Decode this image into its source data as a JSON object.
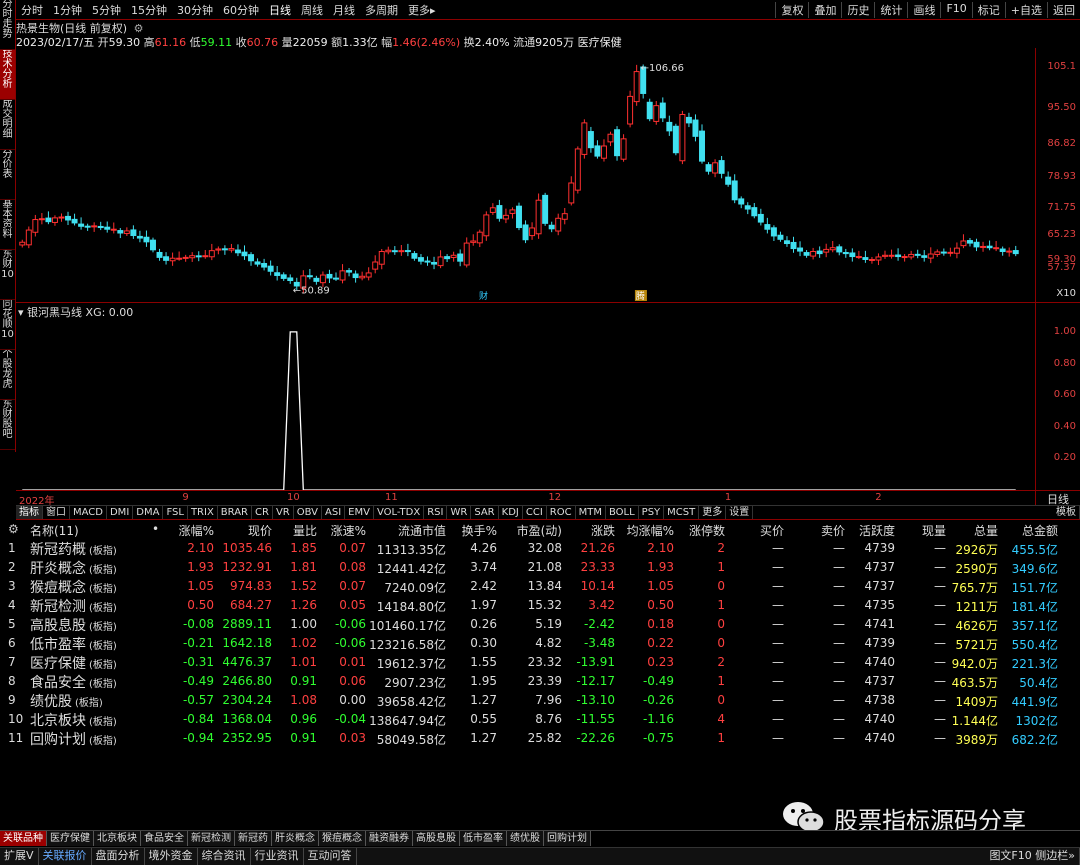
{
  "sidebar": [
    {
      "label": "分时走势",
      "active": false
    },
    {
      "label": "技术分析",
      "active": true
    },
    {
      "label": "成交明细",
      "active": false
    },
    {
      "label": "分价表",
      "active": false
    },
    {
      "label": "基本资料",
      "active": false
    },
    {
      "label": "东财10",
      "active": false
    },
    {
      "label": "同花顺10",
      "active": false
    },
    {
      "label": "个股龙虎",
      "active": false
    },
    {
      "label": "东财股吧",
      "active": false
    }
  ],
  "periods": [
    "分时",
    "1分钟",
    "5分钟",
    "15分钟",
    "30分钟",
    "60分钟",
    "日线",
    "周线",
    "月线",
    "多周期",
    "更多▸"
  ],
  "period_active": "日线",
  "toolbar_right": [
    "复权",
    "叠加",
    "历史",
    "统计",
    "画线",
    "F10",
    "标记",
    "+自选",
    "返回"
  ],
  "title": "热景生物(日线 前复权)",
  "quote": {
    "date": "2023/02/17/五",
    "open_label": "开",
    "open": "59.30",
    "high_label": "高",
    "high": "61.16",
    "low_label": "低",
    "low": "59.11",
    "close_label": "收",
    "close": "60.76",
    "vol_label": "量",
    "vol": "22059",
    "amt_label": "额",
    "amt": "1.33亿",
    "chg_label": "幅",
    "chg": "1.46(2.46%)",
    "turn_label": "换",
    "turn": "2.40%",
    "float_label": "流通",
    "float": "9205万",
    "sector": "医疗保健"
  },
  "chart_data": [
    {
      "type": "candlestick",
      "title": "热景生物(日线 前复权)",
      "y_ticks": [
        "105.1",
        "95.50",
        "86.82",
        "78.93",
        "71.75",
        "65.23",
        "59.30",
        "57.37"
      ],
      "ylim": [
        50,
        109
      ],
      "high_marker": "106.66",
      "low_marker": "50.89",
      "event_markers": [
        "财",
        "腾"
      ],
      "x_labels": [
        "2022年",
        "9",
        "10",
        "11",
        "12",
        "1",
        "2"
      ],
      "scale_label": "X10",
      "closes": [
        63.5,
        66.4,
        68.9,
        69.1,
        68.4,
        69.3,
        69.5,
        68.8,
        68.1,
        67.3,
        67.2,
        67.4,
        67.0,
        66.6,
        66.6,
        65.7,
        66.2,
        65.1,
        64.5,
        63.6,
        61.7,
        59.9,
        59.2,
        59.7,
        59.7,
        59.9,
        60.3,
        60.2,
        60.3,
        61.5,
        61.9,
        61.7,
        62.0,
        61.0,
        60.3,
        59.1,
        58.3,
        57.6,
        56.6,
        55.6,
        54.9,
        54.4,
        53.1,
        55.5,
        55.3,
        54.2,
        55.7,
        55.0,
        54.9,
        56.7,
        56.4,
        55.1,
        55.4,
        56.2,
        58.8,
        61.3,
        61.6,
        61.3,
        61.5,
        61.4,
        59.7,
        59.0,
        58.9,
        58.3,
        60.0,
        59.6,
        60.4,
        59.0,
        63.3,
        63.8,
        65.9,
        70.0,
        71.7,
        69.2,
        69.9,
        71.2,
        67.0,
        64.1,
        66.9,
        73.5,
        68.0,
        66.7,
        69.2,
        70.3,
        77.6,
        85.7,
        91.9,
        86.0,
        84.0,
        86.4,
        89.2,
        84.1,
        88.1,
        98.2,
        104.1,
        98.9,
        92.9,
        96.0,
        93.1,
        90.0,
        84.8,
        93.9,
        91.9,
        88.7,
        82.8,
        80.4,
        82.4,
        79.9,
        77.3,
        73.6,
        72.6,
        71.4,
        69.8,
        68.3,
        66.6,
        65.0,
        64.2,
        63.2,
        62.0,
        61.4,
        60.4,
        61.3,
        60.8,
        61.8,
        62.2,
        61.2,
        60.8,
        60.1,
        60.1,
        59.4,
        59.4,
        60.0,
        60.4,
        60.4,
        60.1,
        60.1,
        60.6,
        60.5,
        59.9,
        60.7,
        61.2,
        61.1,
        61.1,
        62.1,
        63.8,
        63.3,
        62.4,
        62.5,
        62.2,
        62.2,
        61.3,
        61.4,
        60.8
      ]
    },
    {
      "type": "line",
      "title": "银河黑马线",
      "label": "银河黑马线 XG: 0.00",
      "y_ticks": [
        "1.00",
        "0.80",
        "0.60",
        "0.40",
        "0.20"
      ],
      "ylim": [
        0,
        1.05
      ],
      "peak_start_index": 41,
      "peak_end_index": 42
    }
  ],
  "indicator_tabs": [
    "指标",
    "窗口",
    "MACD",
    "DMI",
    "DMA",
    "FSL",
    "TRIX",
    "BRAR",
    "CR",
    "VR",
    "OBV",
    "ASI",
    "EMV",
    "VOL-TDX",
    "RSI",
    "WR",
    "SAR",
    "KDJ",
    "CCI",
    "ROC",
    "MTM",
    "BOLL",
    "PSY",
    "MCST",
    "更多",
    "设置"
  ],
  "indicator_right": [
    "模板",
    "日线"
  ],
  "table": {
    "headers": [
      "名称(11)",
      "•",
      "涨幅%",
      "现价",
      "量比",
      "涨速%",
      "流通市值",
      "换手%",
      "市盈(动)",
      "涨跌",
      "均涨幅%",
      "涨停数",
      "买价",
      "卖价",
      "活跃度",
      "现量",
      "总量",
      "总金额"
    ],
    "rows": [
      {
        "n": "1",
        "name": "新冠药概",
        "tag": "(板指)",
        "chg": "2.10",
        "price": "1035.46",
        "vr": "1.85",
        "spd": "0.07",
        "cap": "11313.35亿",
        "turn": "4.26",
        "pe": "32.08",
        "diff": "21.26",
        "avg": "2.10",
        "lim": "2",
        "bid": "—",
        "ask": "—",
        "act": "4739",
        "cur": "—",
        "vol": "2926万",
        "amt": "455.5亿",
        "c": "red",
        "cv": "red",
        "cs": "red",
        "cd": "red",
        "ca": "red",
        "cl": "red"
      },
      {
        "n": "2",
        "name": "肝炎概念",
        "tag": "(板指)",
        "chg": "1.93",
        "price": "1232.91",
        "vr": "1.81",
        "spd": "0.08",
        "cap": "12441.42亿",
        "turn": "3.74",
        "pe": "21.08",
        "diff": "23.33",
        "avg": "1.93",
        "lim": "1",
        "bid": "—",
        "ask": "—",
        "act": "4737",
        "cur": "—",
        "vol": "2590万",
        "amt": "349.6亿",
        "c": "red",
        "cv": "red",
        "cs": "red",
        "cd": "red",
        "ca": "red",
        "cl": "red"
      },
      {
        "n": "3",
        "name": "猴痘概念",
        "tag": "(板指)",
        "chg": "1.05",
        "price": "974.83",
        "vr": "1.52",
        "spd": "0.07",
        "cap": "7240.09亿",
        "turn": "2.42",
        "pe": "13.84",
        "diff": "10.14",
        "avg": "1.05",
        "lim": "0",
        "bid": "—",
        "ask": "—",
        "act": "4737",
        "cur": "—",
        "vol": "765.7万",
        "amt": "151.7亿",
        "c": "red",
        "cv": "red",
        "cs": "red",
        "cd": "red",
        "ca": "red",
        "cl": "red"
      },
      {
        "n": "4",
        "name": "新冠检测",
        "tag": "(板指)",
        "chg": "0.50",
        "price": "684.27",
        "vr": "1.26",
        "spd": "0.05",
        "cap": "14184.80亿",
        "turn": "1.97",
        "pe": "15.32",
        "diff": "3.42",
        "avg": "0.50",
        "lim": "1",
        "bid": "—",
        "ask": "—",
        "act": "4735",
        "cur": "—",
        "vol": "1211万",
        "amt": "181.4亿",
        "c": "red",
        "cv": "red",
        "cs": "red",
        "cd": "red",
        "ca": "red",
        "cl": "red"
      },
      {
        "n": "5",
        "name": "高股息股",
        "tag": "(板指)",
        "chg": "-0.08",
        "price": "2889.11",
        "vr": "1.00",
        "spd": "-0.06",
        "cap": "101460.17亿",
        "turn": "0.26",
        "pe": "5.19",
        "diff": "-2.42",
        "avg": "0.18",
        "lim": "0",
        "bid": "—",
        "ask": "—",
        "act": "4741",
        "cur": "—",
        "vol": "4626万",
        "amt": "357.1亿",
        "c": "grn",
        "cv": "wht",
        "cs": "grn",
        "cd": "grn",
        "ca": "red",
        "cl": "red"
      },
      {
        "n": "6",
        "name": "低市盈率",
        "tag": "(板指)",
        "chg": "-0.21",
        "price": "1642.18",
        "vr": "1.02",
        "spd": "-0.06",
        "cap": "123216.58亿",
        "turn": "0.30",
        "pe": "4.82",
        "diff": "-3.48",
        "avg": "0.22",
        "lim": "0",
        "bid": "—",
        "ask": "—",
        "act": "4739",
        "cur": "—",
        "vol": "5721万",
        "amt": "550.4亿",
        "c": "grn",
        "cv": "red",
        "cs": "grn",
        "cd": "grn",
        "ca": "red",
        "cl": "red"
      },
      {
        "n": "7",
        "name": "医疗保健",
        "tag": "(板指)",
        "chg": "-0.31",
        "price": "4476.37",
        "vr": "1.01",
        "spd": "0.01",
        "cap": "19612.37亿",
        "turn": "1.55",
        "pe": "23.32",
        "diff": "-13.91",
        "avg": "0.23",
        "lim": "2",
        "bid": "—",
        "ask": "—",
        "act": "4740",
        "cur": "—",
        "vol": "942.0万",
        "amt": "221.3亿",
        "c": "grn",
        "cv": "red",
        "cs": "red",
        "cd": "grn",
        "ca": "red",
        "cl": "red"
      },
      {
        "n": "8",
        "name": "食品安全",
        "tag": "(板指)",
        "chg": "-0.49",
        "price": "2466.80",
        "vr": "0.91",
        "spd": "0.06",
        "cap": "2907.23亿",
        "turn": "1.95",
        "pe": "23.39",
        "diff": "-12.17",
        "avg": "-0.49",
        "lim": "1",
        "bid": "—",
        "ask": "—",
        "act": "4737",
        "cur": "—",
        "vol": "463.5万",
        "amt": "50.4亿",
        "c": "grn",
        "cv": "grn",
        "cs": "red",
        "cd": "grn",
        "ca": "grn",
        "cl": "red"
      },
      {
        "n": "9",
        "name": "绩优股",
        "tag": "(板指)",
        "chg": "-0.57",
        "price": "2304.24",
        "vr": "1.08",
        "spd": "0.00",
        "cap": "39658.42亿",
        "turn": "1.27",
        "pe": "7.96",
        "diff": "-13.10",
        "avg": "-0.26",
        "lim": "0",
        "bid": "—",
        "ask": "—",
        "act": "4738",
        "cur": "—",
        "vol": "1409万",
        "amt": "441.9亿",
        "c": "grn",
        "cv": "red",
        "cs": "wht",
        "cd": "grn",
        "ca": "grn",
        "cl": "red"
      },
      {
        "n": "10",
        "name": "北京板块",
        "tag": "(板指)",
        "chg": "-0.84",
        "price": "1368.04",
        "vr": "0.96",
        "spd": "-0.04",
        "cap": "138647.94亿",
        "turn": "0.55",
        "pe": "8.76",
        "diff": "-11.55",
        "avg": "-1.16",
        "lim": "4",
        "bid": "—",
        "ask": "—",
        "act": "4740",
        "cur": "—",
        "vol": "1.144亿",
        "amt": "1302亿",
        "c": "grn",
        "cv": "grn",
        "cs": "grn",
        "cd": "grn",
        "ca": "grn",
        "cl": "red"
      },
      {
        "n": "11",
        "name": "回购计划",
        "tag": "(板指)",
        "chg": "-0.94",
        "price": "2352.95",
        "vr": "0.91",
        "spd": "0.03",
        "cap": "58049.58亿",
        "turn": "1.27",
        "pe": "25.82",
        "diff": "-22.26",
        "avg": "-0.75",
        "lim": "1",
        "bid": "—",
        "ask": "—",
        "act": "4740",
        "cur": "—",
        "vol": "3989万",
        "amt": "682.2亿",
        "c": "grn",
        "cv": "grn",
        "cs": "red",
        "cd": "grn",
        "ca": "grn",
        "cl": "red"
      }
    ]
  },
  "bottom_tabs": [
    "关联品种",
    "医疗保健",
    "北京板块",
    "食品安全",
    "新冠检测",
    "新冠药",
    "肝炎概念",
    "猴痘概念",
    "融资融券",
    "高股息股",
    "低市盈率",
    "绩优股",
    "回购计划"
  ],
  "status_tabs": [
    "扩展V",
    "关联报价",
    "盘面分析",
    "境外资金",
    "综合资讯",
    "行业资讯",
    "互动问答"
  ],
  "status_right": "图文F10 侧边栏»",
  "watermark": "股票指标源码分享",
  "colors": {
    "up": "#ff3030",
    "down": "#40e0f0",
    "axis": "#e04040",
    "grid": "#8b0000"
  }
}
